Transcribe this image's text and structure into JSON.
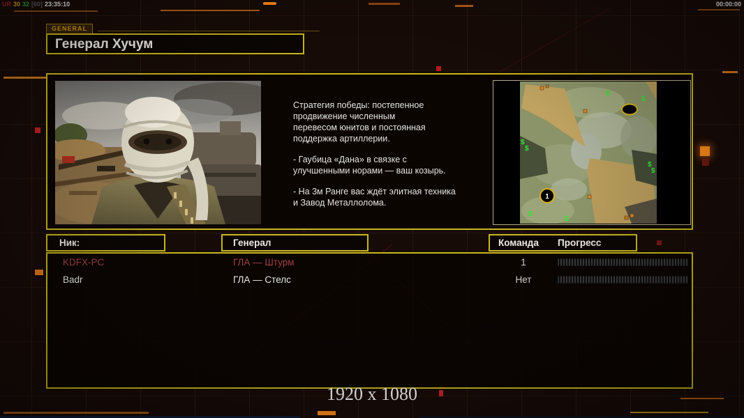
{
  "status_bar": {
    "left": {
      "label": "UR",
      "value1": "30",
      "value2": "32",
      "value3": "[60]",
      "time": "23:35:10"
    },
    "timer": "00:00:00"
  },
  "header": {
    "tab": "GENERAL",
    "title": "Генерал Хучум"
  },
  "briefing": {
    "p1": "Стратегия победы: постепенное\nпродвижение численным\nперевесом юнитов и постоянная\nподдержка артиллерии.",
    "p2": "- Гаубица «Дана» в связке с\nулучшенными норами — ваш козырь.",
    "p3": "- На 3м Ранге вас ждёт элитная техника\nи Завод Металлолома."
  },
  "minimap": {
    "start_marker": "1",
    "money_icon": "$"
  },
  "players": {
    "headers": {
      "nick": "Ник:",
      "general": "Генерал",
      "team": "Команда",
      "progress": "Прогресс"
    },
    "rows": [
      {
        "nick": "KDFX-PC",
        "general": "ГЛА — Штурм",
        "team": "1",
        "progress_percent": 2,
        "color": "#a14042"
      },
      {
        "nick": "Badr",
        "general": "ГЛА — Стелс",
        "team": "Нет",
        "progress_percent": 0,
        "color": "#e6e6e6"
      }
    ]
  },
  "footer": {
    "resolution": "1920 x 1080"
  },
  "colors": {
    "accent_border": "#c9b71c",
    "decor_orange": "#ff8c1a",
    "background": "#170b07"
  }
}
